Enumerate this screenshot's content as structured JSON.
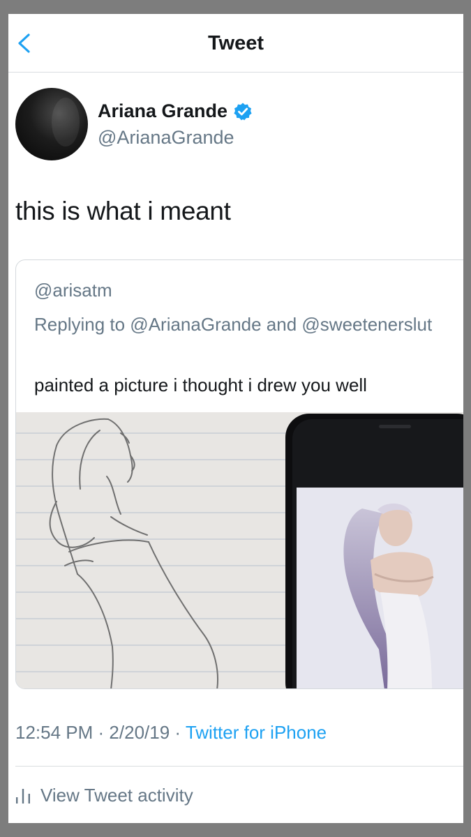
{
  "header": {
    "title": "Tweet",
    "back_icon": "chevron-left-icon"
  },
  "tweet": {
    "author_name": "Ariana Grande",
    "author_handle": "@ArianaGrande",
    "verified_icon": "verified-badge-icon",
    "text": "this is what i meant",
    "quoted": {
      "handle": "@arisatm",
      "replying_to": "Replying to @ArianaGrande and @sweetenerslut",
      "text": "painted a picture i thought i drew you well"
    },
    "time": "12:54 PM",
    "date": "2/20/19",
    "separator": "·",
    "source": "Twitter for iPhone"
  },
  "footer": {
    "activity_label": "View Tweet activity",
    "activity_icon": "bar-chart-icon"
  },
  "colors": {
    "accent": "#1da1f2",
    "secondary_text": "#657786",
    "primary_text": "#14171a"
  }
}
